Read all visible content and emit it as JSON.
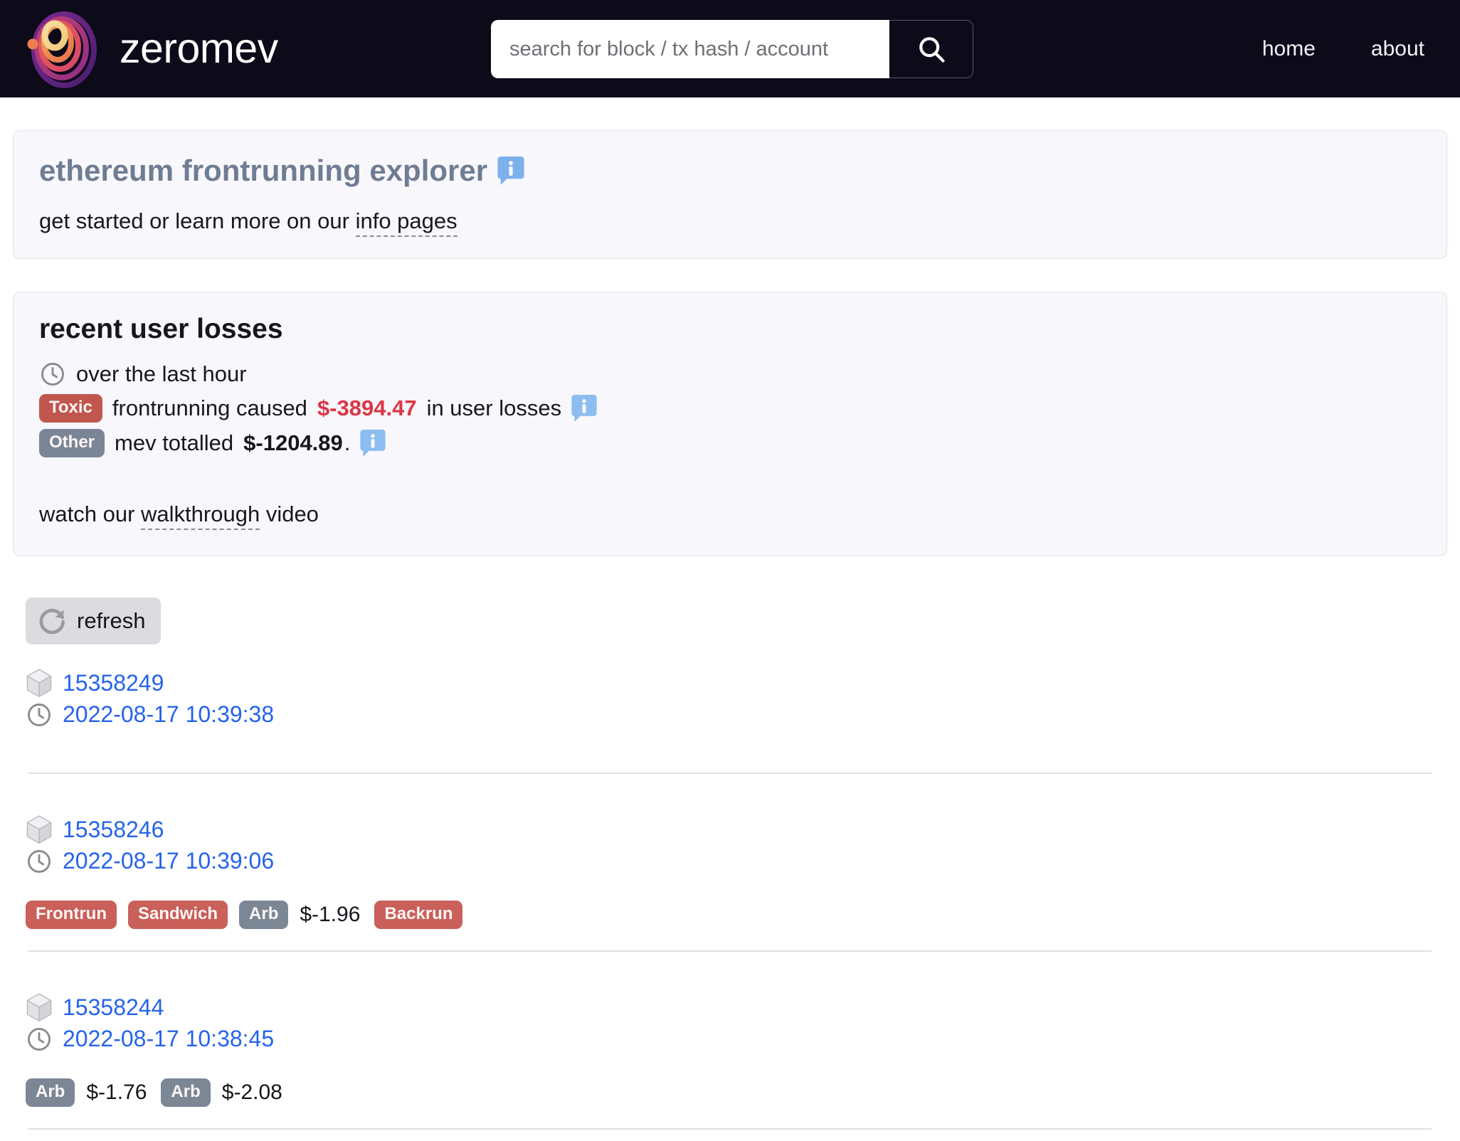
{
  "header": {
    "brand": "zeromev",
    "logo_icon": "zeromev-rings-logo",
    "search": {
      "placeholder": "search for block / tx hash / account",
      "value": "",
      "button_icon": "search-icon"
    },
    "nav": [
      {
        "label": "home"
      },
      {
        "label": "about"
      }
    ]
  },
  "intro": {
    "title": "ethereum frontrunning explorer",
    "title_info_icon": "info-icon",
    "line_before": "get started or learn more on our",
    "link": "info pages"
  },
  "losses": {
    "title": "recent user losses",
    "clock_icon": "clock-icon",
    "period": "over the last hour",
    "toxic_badge": "Toxic",
    "toxic_text_before": "frontrunning caused",
    "toxic_amount": "$-3894.47",
    "toxic_text_after": "in user losses",
    "toxic_info_icon": "info-icon",
    "other_badge": "Other",
    "other_text_before": "mev totalled",
    "other_amount": "$-1204.89",
    "other_text_after": ".",
    "other_info_icon": "info-icon",
    "watch_before": "watch our",
    "watch_link": "walkthrough",
    "watch_after": "video"
  },
  "refresh": {
    "label": "refresh",
    "icon": "refresh-icon"
  },
  "blocks": [
    {
      "block_icon": "cube-icon",
      "number": "15358249",
      "time_icon": "clock-icon",
      "time": "2022-08-17 10:39:38",
      "tags": []
    },
    {
      "block_icon": "cube-icon",
      "number": "15358246",
      "time_icon": "clock-icon",
      "time": "2022-08-17 10:39:06",
      "tags": [
        {
          "label": "Frontrun",
          "style": "red",
          "amount": ""
        },
        {
          "label": "Sandwich",
          "style": "red",
          "amount": ""
        },
        {
          "label": "Arb",
          "style": "slate",
          "amount": "$-1.96"
        },
        {
          "label": "Backrun",
          "style": "red",
          "amount": ""
        }
      ]
    },
    {
      "block_icon": "cube-icon",
      "number": "15358244",
      "time_icon": "clock-icon",
      "time": "2022-08-17 10:38:45",
      "tags": [
        {
          "label": "Arb",
          "style": "slate",
          "amount": "$-1.76"
        },
        {
          "label": "Arb",
          "style": "slate",
          "amount": "$-2.08"
        }
      ]
    }
  ],
  "colors": {
    "header_bg": "#0d0a1a",
    "link_blue": "#2563eb",
    "title_blue_grey": "#6e7d93",
    "toxic_red": "#c0574f",
    "other_slate": "#7a8596",
    "amount_red": "#dc3545",
    "card_bg": "#f8f7fb"
  }
}
